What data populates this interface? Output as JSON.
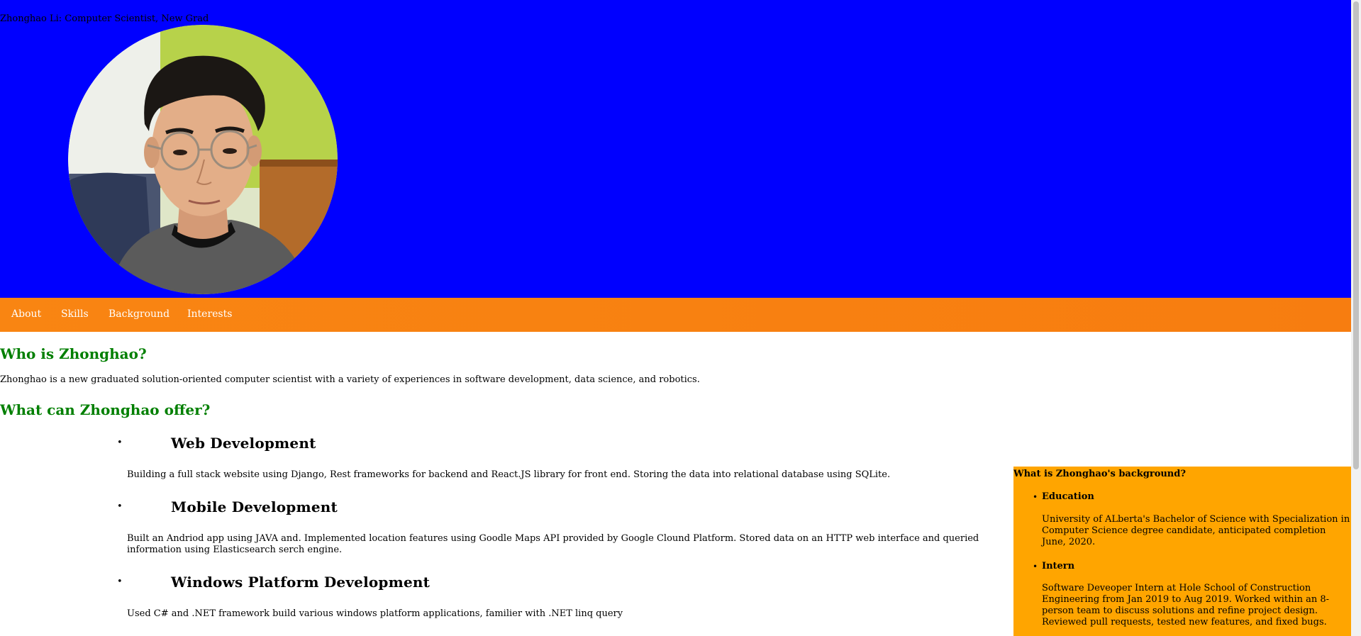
{
  "header": {
    "site_title": "Zhonghao Li: Computer Scientist, New Grad"
  },
  "nav": {
    "items": [
      "About",
      "Skills",
      "Background",
      "Interests"
    ]
  },
  "about": {
    "heading": "Who is Zhonghao?",
    "text": "Zhonghao is a new graduated solution-oriented computer scientist with a variety of experiences in software development, data science, and robotics."
  },
  "skills": {
    "heading": "What can Zhonghao offer?",
    "items": [
      {
        "title": "Web Development",
        "text": "Building a full stack website using Django, Rest frameworks for backend and React.JS library for front end. Storing the data into relational database using SQLite."
      },
      {
        "title": "Mobile Development",
        "text": "Built an Andriod app using JAVA and. Implemented location features using Goodle Maps API provided by Google Clound Platform. Stored data on an HTTP web interface and queried information using Elasticsearch serch engine."
      },
      {
        "title": "Windows Platform Development",
        "text": "Used C# and .NET framework build various windows platform applications, familier with .NET linq query"
      }
    ]
  },
  "background": {
    "heading": "What is Zhonghao's background?",
    "items": [
      {
        "title": "Education",
        "text": "University of ALberta's Bachelor of Science with Specialization in Computer Science degree candidate, anticipated completion June, 2020."
      },
      {
        "title": "Intern",
        "text": "Software Deveoper Intern at Hole School of Construction Engineering from Jan 2019 to Aug 2019. Worked within an 8-person team to discuss solutions and refine project design. Reviewed pull requests, tested new features, and fixed bugs."
      }
    ]
  },
  "colors": {
    "header_bg": "#0000ff",
    "nav_bg": "#f98512",
    "heading_green": "#007f00",
    "sidebar_bg": "#ffa500"
  }
}
